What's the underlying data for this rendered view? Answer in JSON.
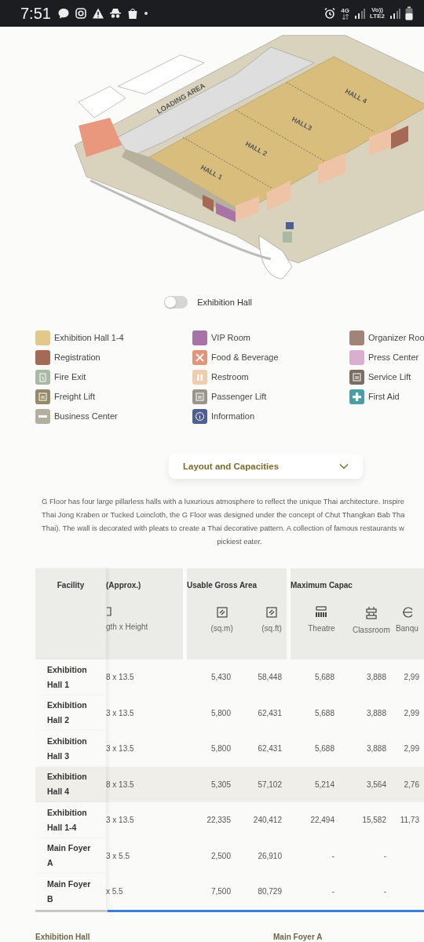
{
  "status_bar": {
    "time": "7:51",
    "network": "4G",
    "volte": "Vo))",
    "lte": "LTE2"
  },
  "floor_plan": {
    "labels": [
      {
        "text": "LOADING AREA",
        "kind": "area"
      },
      {
        "text": "HALL 1",
        "kind": "hall"
      },
      {
        "text": "HALL 2",
        "kind": "hall"
      },
      {
        "text": "HALL3",
        "kind": "hall"
      },
      {
        "text": "HALL 4",
        "kind": "hall"
      }
    ]
  },
  "toggle": {
    "label": "Exhibition Hall",
    "on": false
  },
  "legend": {
    "columns": [
      [
        {
          "label": "Exhibition Hall 1-4",
          "color": "#e2c98a",
          "kind": "plain"
        },
        {
          "label": "Registration",
          "color": "#a56a56",
          "kind": "plain"
        },
        {
          "label": "Fire Exit",
          "color": "#a9b9a4",
          "kind": "exit"
        },
        {
          "label": "Freight Lift",
          "color": "#948a67",
          "kind": "lift"
        },
        {
          "label": "Business Center",
          "color": "#b3b0a2",
          "kind": "business"
        }
      ],
      [
        {
          "label": "VIP Room",
          "color": "#a874a8",
          "kind": "plain"
        },
        {
          "label": "Food & Beverage",
          "color": "#e3957c",
          "kind": "food"
        },
        {
          "label": "Restroom",
          "color": "#efcdb1",
          "kind": "restroom"
        },
        {
          "label": "Passenger Lift",
          "color": "#9b968a",
          "kind": "lift"
        },
        {
          "label": "Information",
          "color": "#4f5e93",
          "kind": "info"
        }
      ],
      [
        {
          "label": "Organizer Roo",
          "color": "#a08478",
          "kind": "plain"
        },
        {
          "label": "Press Center",
          "color": "#d9aed1",
          "kind": "plain"
        },
        {
          "label": "Service Lift",
          "color": "#7c6d62",
          "kind": "lift"
        },
        {
          "label": "First Aid",
          "color": "#4a9ea6",
          "kind": "aid"
        }
      ]
    ]
  },
  "accordion": {
    "title": "Layout and Capacities",
    "expanded": false
  },
  "description": {
    "lines": [
      "G Floor has four large pillarless halls with a luxurious atmosphere to reflect the unique Thai architecture. Inspire",
      "Thai Jong Kraben or Tucked Loincloth, the G Floor was designed under the concept of Chut Thangkan Bab Tha",
      "Thai). The wall is decorated with pleats to create a Thai decorative pattern. A collection of famous restaurants w",
      "pickiest eater."
    ]
  },
  "table": {
    "groups": [
      {
        "label": "Facility"
      },
      {
        "label": "(Approx.)"
      },
      {
        "label": "Usable Gross Area"
      },
      {
        "label": "Maximum Capac"
      }
    ],
    "columns": [
      {
        "label": "gth x Height",
        "kind": "dims"
      },
      {
        "label": "(sq.m)",
        "kind": "area"
      },
      {
        "label": "(sq.ft)",
        "kind": "area"
      },
      {
        "label": "Theatre",
        "kind": "theatre"
      },
      {
        "label": "Classroom",
        "kind": "classroom"
      },
      {
        "label": "Banqu",
        "kind": "banquet"
      }
    ],
    "rows": [
      {
        "facility": "Exhibition Hall 1",
        "highlighted": false,
        "cells": [
          "8 x 13.5",
          "5,430",
          "58,448",
          "5,688",
          "3,888",
          "2,99"
        ]
      },
      {
        "facility": "Exhibition Hall 2",
        "highlighted": false,
        "cells": [
          "3 x 13.5",
          "5,800",
          "62,431",
          "5,688",
          "3,888",
          "2,99"
        ]
      },
      {
        "facility": "Exhibition Hall 3",
        "highlighted": false,
        "cells": [
          "3 x 13.5",
          "5,800",
          "62,431",
          "5,688",
          "3,888",
          "2,99"
        ]
      },
      {
        "facility": "Exhibition Hall 4",
        "highlighted": true,
        "cells": [
          "8 x 13.5",
          "5,305",
          "57,102",
          "5,214",
          "3,564",
          "2,76"
        ]
      },
      {
        "facility": "Exhibition Hall 1-4",
        "highlighted": false,
        "cells": [
          "3 x 13.5",
          "22,335",
          "240,412",
          "22,494",
          "15,582",
          "11,73"
        ]
      },
      {
        "facility": "Main Foyer A",
        "highlighted": false,
        "cells": [
          "3 x 5.5",
          "2,500",
          "26,910",
          "-",
          "-"
        ]
      },
      {
        "facility": "Main Foyer B",
        "highlighted": false,
        "cells": [
          "x 5.5",
          "7,500",
          "80,729",
          "-",
          "-"
        ]
      }
    ]
  },
  "section_labels": [
    "Exhibition Hall",
    "Main Foyer A"
  ]
}
